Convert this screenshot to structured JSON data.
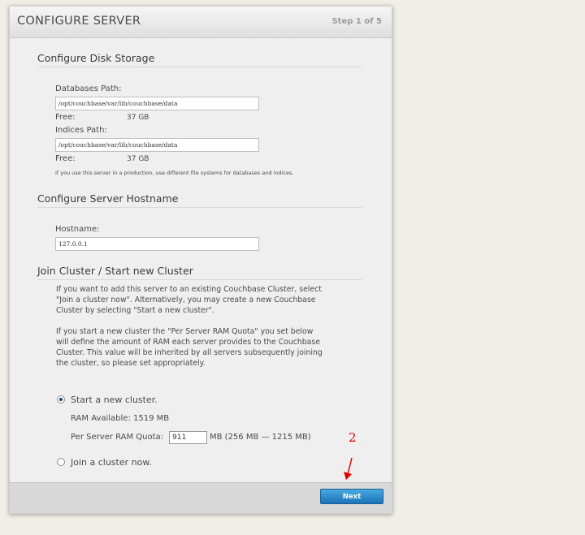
{
  "header": {
    "title": "CONFIGURE SERVER",
    "step": "Step 1 of 5"
  },
  "disk": {
    "title": "Configure Disk Storage",
    "db_label": "Databases Path:",
    "db_path": "/opt/couchbase/var/lib/couchbase/data",
    "db_free_label": "Free:",
    "db_free_value": "37 GB",
    "idx_label": "Indices Path:",
    "idx_path": "/opt/couchbase/var/lib/couchbase/data",
    "idx_free_label": "Free:",
    "idx_free_value": "37 GB",
    "note": "If you use this server in a production, use different file systems for databases and indices."
  },
  "hostname": {
    "title": "Configure Server Hostname",
    "label": "Hostname:",
    "value": "127.0.0.1"
  },
  "cluster": {
    "title": "Join Cluster / Start new Cluster",
    "para1": "If you want to add this server to an existing Couchbase Cluster, select \"Join a cluster now\". Alternatively, you may create a new Couchbase Cluster by selecting \"Start a new cluster\".",
    "para2": "If you start a new cluster the \"Per Server RAM Quota\" you set below will define the amount of RAM each server provides to the Couchbase Cluster. This value will be inherited by all servers subsequently joining the cluster, so please set appropriately.",
    "start_new_label": "Start a new cluster.",
    "start_new_selected": true,
    "ram_available": "RAM Available: 1519 MB",
    "quota_label": "Per Server RAM Quota:",
    "quota_value": "911",
    "quota_range": "MB (256 MB — 1215 MB)",
    "join_label": "Join a cluster now.",
    "join_selected": false
  },
  "footer": {
    "next_label": "Next"
  },
  "annotation": {
    "number": "2",
    "color": "#e00000"
  },
  "colors": {
    "accent": "#1a73b7",
    "background": "#f1eee7",
    "panel": "#efefef"
  }
}
